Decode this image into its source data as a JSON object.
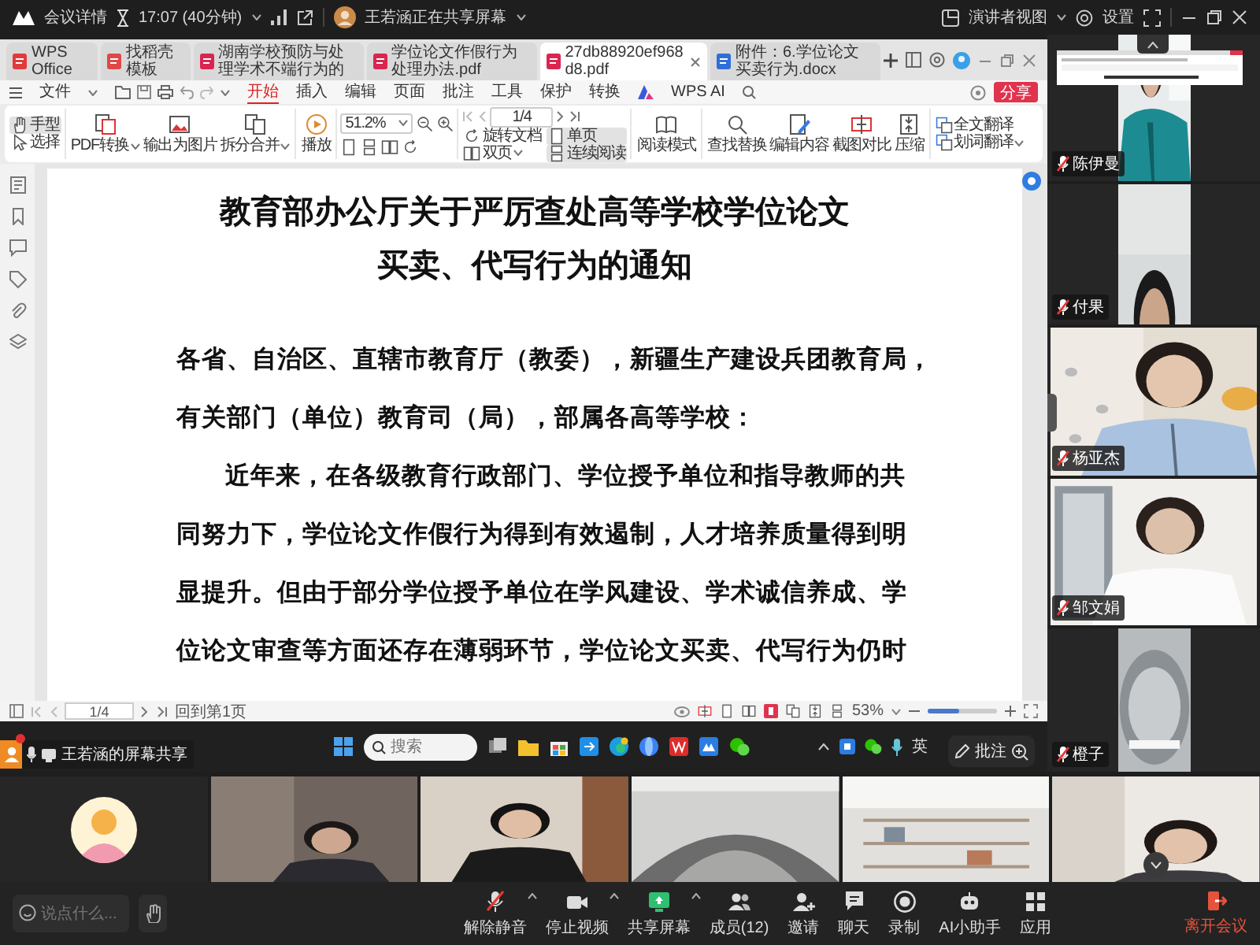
{
  "top_bar": {
    "meeting_details": "会议详情",
    "timer": "17:07 (40分钟)",
    "sharing_notice": "王若涵正在共享屏幕",
    "view_mode": "演讲者视图",
    "settings": "设置"
  },
  "shared_screen": {
    "tabs": [
      {
        "kind": "home",
        "label": "WPS Office",
        "selected": false
      },
      {
        "kind": "template",
        "label": "找稻壳模板",
        "selected": false
      },
      {
        "kind": "pdf",
        "label": "湖南学校预防与处理学术不端行为的",
        "selected": false
      },
      {
        "kind": "pdf",
        "label": "学位论文作假行为处理办法.pdf",
        "selected": false
      },
      {
        "kind": "pdf",
        "label": "27db88920ef968d8.pdf",
        "selected": true
      },
      {
        "kind": "docx",
        "label": "附件：6.学位论文买卖行为.docx",
        "selected": false
      }
    ],
    "file_menu": "文件",
    "menu": [
      {
        "label": "开始",
        "selected": true
      },
      {
        "label": "插入",
        "selected": false
      },
      {
        "label": "编辑",
        "selected": false
      },
      {
        "label": "页面",
        "selected": false
      },
      {
        "label": "批注",
        "selected": false
      },
      {
        "label": "工具",
        "selected": false
      },
      {
        "label": "保护",
        "selected": false
      },
      {
        "label": "转换",
        "selected": false
      }
    ],
    "ai_menu": "WPS AI",
    "share_button": "分享",
    "ribbon": [
      {
        "items": [
          {
            "kind": "small",
            "label": "手型",
            "selected": true,
            "menu": false
          },
          {
            "kind": "small",
            "label": "选择",
            "selected": false,
            "menu": false
          }
        ]
      },
      {
        "items": [
          {
            "kind": "big",
            "label": "PDF转换",
            "selected": false,
            "menu": true
          },
          {
            "kind": "big",
            "label": "输出为图片",
            "selected": false,
            "menu": false
          },
          {
            "kind": "big",
            "label": "拆分合并",
            "selected": false,
            "menu": true
          }
        ]
      },
      {
        "items": [
          {
            "kind": "big",
            "label": "播放",
            "selected": false,
            "menu": false
          }
        ]
      },
      {
        "items": [
          {
            "kind": "zoom",
            "value": "51.2%"
          }
        ]
      },
      {
        "items": [
          {
            "kind": "page",
            "value": "1/4"
          },
          {
            "kind": "small",
            "label": "旋转文档",
            "selected": false,
            "menu": false
          },
          {
            "kind": "small",
            "label": "单页",
            "selected": true,
            "menu": false
          },
          {
            "kind": "small",
            "label": "双页",
            "selected": false,
            "menu": true
          },
          {
            "kind": "small",
            "label": "连续阅读",
            "selected": true,
            "menu": false
          }
        ]
      },
      {
        "items": [
          {
            "kind": "big",
            "label": "阅读模式",
            "selected": false,
            "menu": false
          }
        ]
      },
      {
        "items": [
          {
            "kind": "big",
            "label": "查找替换",
            "selected": false,
            "menu": false
          },
          {
            "kind": "big",
            "label": "编辑内容",
            "selected": false,
            "menu": false
          },
          {
            "kind": "big",
            "label": "截图对比",
            "selected": false,
            "menu": false
          },
          {
            "kind": "big",
            "label": "压缩",
            "selected": false,
            "menu": false
          }
        ]
      },
      {
        "items": [
          {
            "kind": "small",
            "label": "全文翻译",
            "selected": false,
            "menu": false
          },
          {
            "kind": "small",
            "label": "划词翻译",
            "selected": false,
            "menu": true
          }
        ]
      }
    ],
    "document": {
      "title": [
        "教育部办公厅关于严厉查处高等学校学位论文",
        "买卖、代写行为的通知"
      ],
      "lines": [
        {
          "text": "各省、自治区、直辖市教育厅（教委），新疆生产建设兵团教育局，",
          "indent": false
        },
        {
          "text": "有关部门（单位）教育司（局），部属各高等学校：",
          "indent": false
        },
        {
          "text": "近年来，在各级教育行政部门、学位授予单位和指导教师的共",
          "indent": true
        },
        {
          "text": "同努力下，学位论文作假行为得到有效遏制，人才培养质量得到明",
          "indent": false
        },
        {
          "text": "显提升。但由于部分学位授予单位在学风建设、学术诚信养成、学",
          "indent": false
        },
        {
          "text": "位论文审查等方面还存在薄弱环节，学位论文买卖、代写行为仍时",
          "indent": false
        }
      ]
    },
    "status_bar": {
      "page": "1/4",
      "back_to_first": "回到第1页",
      "zoom": "53%",
      "level": 0.45
    },
    "taskbar": {
      "search_placeholder": "搜索",
      "ime_indicator": "英"
    },
    "annotate_tooltip": "批注",
    "share_label": "王若涵的屏幕共享"
  },
  "side_videos": [
    {
      "name": "陈伊曼",
      "muted": true
    },
    {
      "name": "付果",
      "muted": true
    },
    {
      "name": "杨亚杰",
      "muted": true
    },
    {
      "name": "邹文娟",
      "muted": true
    },
    {
      "name": "橙子",
      "muted": true
    }
  ],
  "gallery": [
    {
      "kind": "avatar"
    },
    {
      "kind": "picture"
    },
    {
      "kind": "picture"
    },
    {
      "kind": "picture"
    },
    {
      "kind": "picture"
    },
    {
      "kind": "picture"
    }
  ],
  "bottom_bar": {
    "chat_placeholder": "说点什么...",
    "controls": [
      {
        "kind": "mic",
        "label": "解除静音",
        "menu": true
      },
      {
        "kind": "camera",
        "label": "停止视频",
        "menu": true
      },
      {
        "kind": "screen",
        "label": "共享屏幕",
        "menu": true
      },
      {
        "kind": "members",
        "label": "成员(12)",
        "menu": false
      },
      {
        "kind": "invite",
        "label": "邀请",
        "menu": false
      },
      {
        "kind": "chat",
        "label": "聊天",
        "menu": false
      },
      {
        "kind": "record",
        "label": "录制",
        "menu": false
      },
      {
        "kind": "assistant",
        "label": "AI小助手",
        "menu": false
      },
      {
        "kind": "apps",
        "label": "应用",
        "menu": false
      }
    ],
    "leave": "离开会议"
  }
}
